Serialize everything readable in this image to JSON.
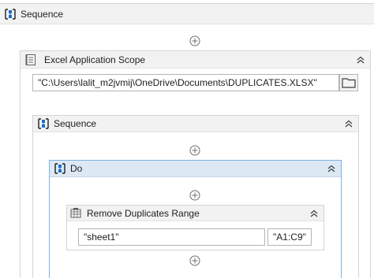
{
  "root_sequence": {
    "title": "Sequence",
    "icon": "sequence-icon"
  },
  "excel_scope": {
    "title": "Excel Application Scope",
    "icon": "excel-scope-icon",
    "workbook_path": "\"C:\\Users\\lalit_m2jvmij\\OneDrive\\Documents\\DUPLICATES.XLSX\"",
    "browse_icon": "folder-icon"
  },
  "inner_sequence": {
    "title": "Sequence",
    "icon": "sequence-icon"
  },
  "do_block": {
    "title": "Do",
    "icon": "sequence-icon"
  },
  "remove_duplicates": {
    "title": "Remove Duplicates Range",
    "icon": "remove-duplicates-icon",
    "sheet_name": "\"sheet1\"",
    "range": "\"A1:C9\""
  },
  "colors": {
    "header_bg": "#f2f2f2",
    "do_header_bg": "#dde8f5",
    "selected_border": "#7fb1e3",
    "sequence_icon_blue": "#1c6fc6"
  }
}
